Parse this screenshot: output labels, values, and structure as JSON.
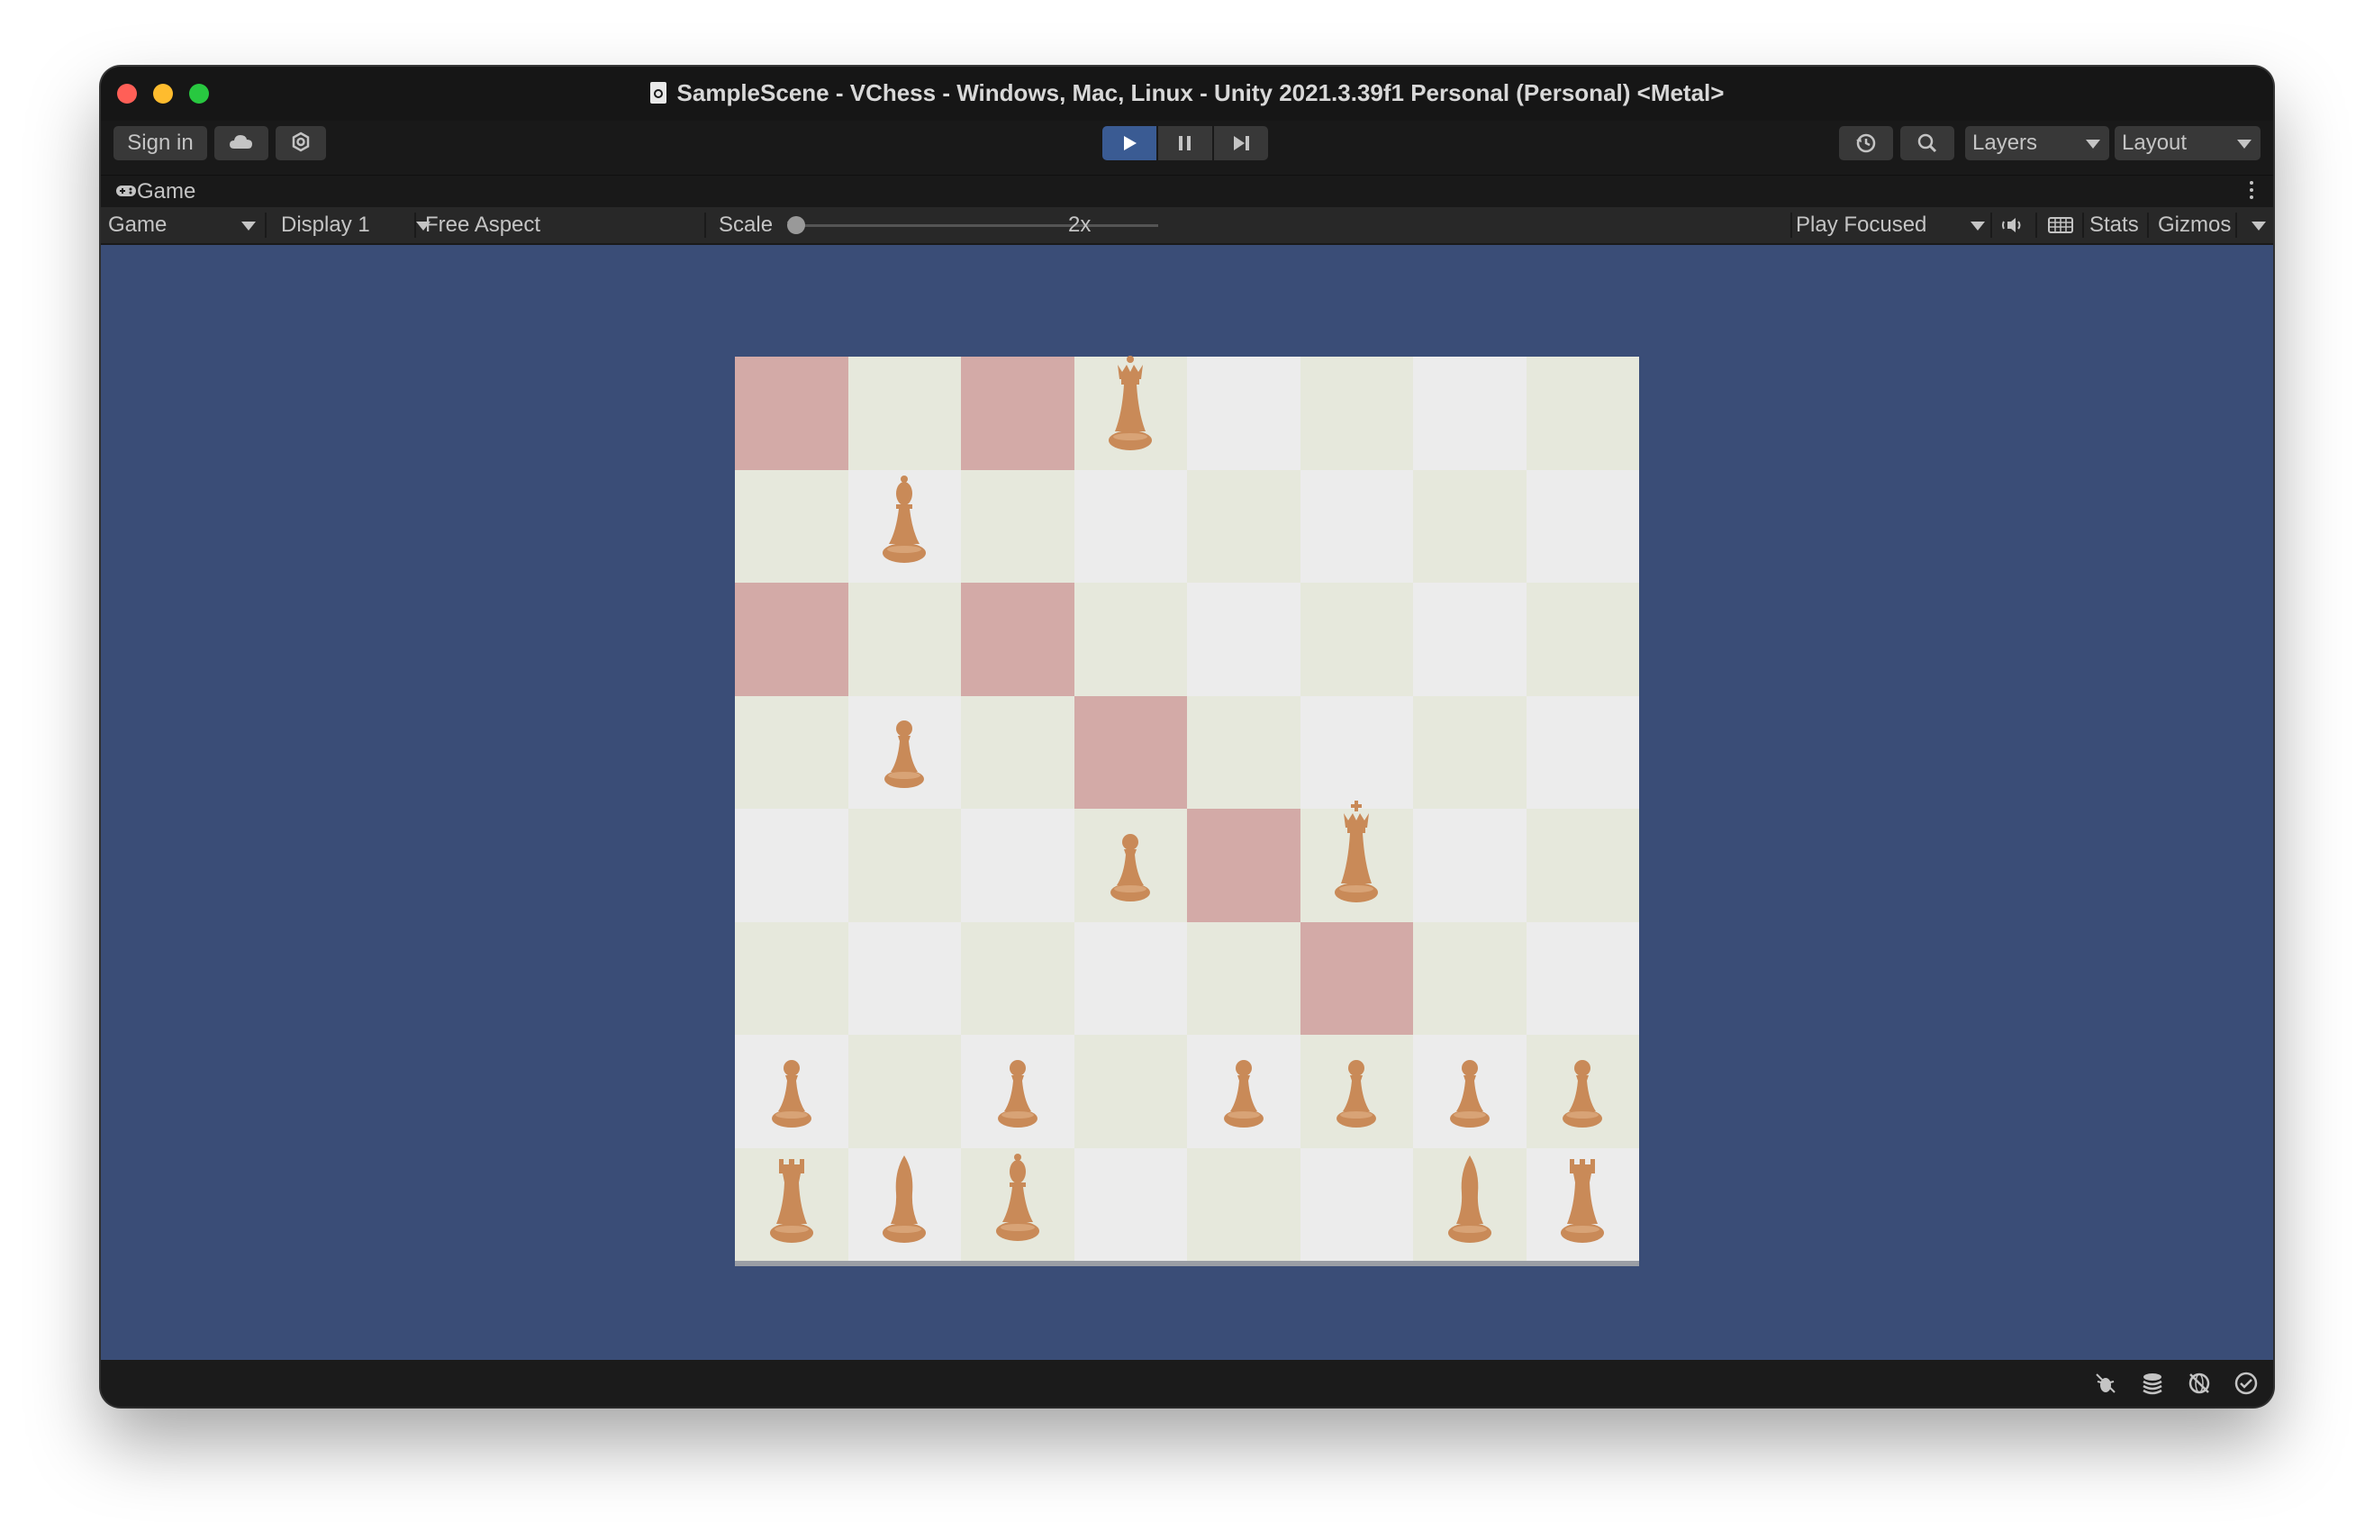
{
  "window": {
    "title": "SampleScene - VChess - Windows, Mac, Linux - Unity 2021.3.39f1 Personal (Personal) <Metal>"
  },
  "toolbar": {
    "sign_in_label": "Sign in",
    "layers_label": "Layers",
    "layout_label": "Layout"
  },
  "tab": {
    "label": "Game"
  },
  "gameview": {
    "view_mode": "Game",
    "display": "Display 1",
    "aspect": "Free Aspect",
    "scale_label": "Scale",
    "scale_value": "2x",
    "play_mode": "Play Focused",
    "stats_label": "Stats",
    "gizmos_label": "Gizmos"
  },
  "colors": {
    "game_background": "#3a4d77",
    "light_square": "#ececec",
    "dark_square": "#e6e8dc",
    "highlight_square": "#d3aaa7",
    "piece_color": "#c98a58",
    "play_active": "#3a5b93"
  },
  "board": {
    "highlights": [
      "0,0",
      "0,2",
      "2,0",
      "2,2",
      "3,3",
      "4,4",
      "5,5"
    ],
    "pieces": [
      {
        "row": 0,
        "col": 3,
        "type": "queen"
      },
      {
        "row": 1,
        "col": 1,
        "type": "bishop"
      },
      {
        "row": 3,
        "col": 1,
        "type": "pawn"
      },
      {
        "row": 4,
        "col": 3,
        "type": "pawn"
      },
      {
        "row": 4,
        "col": 5,
        "type": "king"
      },
      {
        "row": 6,
        "col": 0,
        "type": "pawn"
      },
      {
        "row": 6,
        "col": 2,
        "type": "pawn"
      },
      {
        "row": 6,
        "col": 4,
        "type": "pawn"
      },
      {
        "row": 6,
        "col": 5,
        "type": "pawn"
      },
      {
        "row": 6,
        "col": 6,
        "type": "pawn"
      },
      {
        "row": 6,
        "col": 7,
        "type": "pawn"
      },
      {
        "row": 7,
        "col": 0,
        "type": "rook"
      },
      {
        "row": 7,
        "col": 1,
        "type": "knight"
      },
      {
        "row": 7,
        "col": 2,
        "type": "bishop"
      },
      {
        "row": 7,
        "col": 6,
        "type": "knight"
      },
      {
        "row": 7,
        "col": 7,
        "type": "rook"
      }
    ]
  },
  "status_icons": [
    "bug-icon",
    "layers-stack-icon",
    "network-icon",
    "check-circle-icon"
  ]
}
